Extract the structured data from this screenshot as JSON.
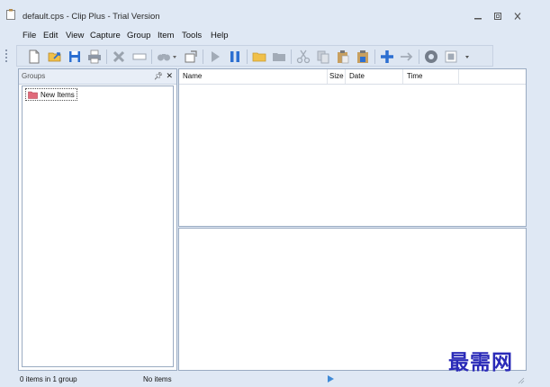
{
  "window": {
    "title": "default.cps - Clip Plus - Trial Version"
  },
  "menu": [
    {
      "label": "File"
    },
    {
      "label": "Edit"
    },
    {
      "label": "View"
    },
    {
      "label": "Capture"
    },
    {
      "label": "Group"
    },
    {
      "label": "Item"
    },
    {
      "label": "Tools"
    },
    {
      "label": "Help"
    }
  ],
  "toolbar": {
    "icons": [
      "new-icon",
      "open-icon",
      "save-icon",
      "print-icon",
      "delete-icon",
      "rename-icon",
      "find-icon",
      "dropdown-icon",
      "capture-window-icon",
      "play-icon",
      "pause-icon",
      "folder-icon",
      "folder-closed-icon",
      "cut-icon",
      "copy-icon",
      "paste-icon",
      "paste-special-icon",
      "add-icon",
      "forward-icon",
      "settings-icon",
      "view-icon",
      "toolbar-options-icon"
    ]
  },
  "groups_pane": {
    "title": "Groups",
    "items": [
      {
        "label": "New Items",
        "icon": "folder-icon"
      }
    ]
  },
  "items_list": {
    "columns": [
      {
        "label": "Name"
      },
      {
        "label": "Size"
      },
      {
        "label": "Date"
      },
      {
        "label": "Time"
      }
    ]
  },
  "statusbar": {
    "left": "0 items in 1 group",
    "middle": "No items"
  },
  "watermark": "最需网",
  "colors": {
    "accent": "#2c6fd1",
    "folder": "#e06a7a",
    "play": "#3f8ad6",
    "watermark": "#2a2ab8"
  }
}
